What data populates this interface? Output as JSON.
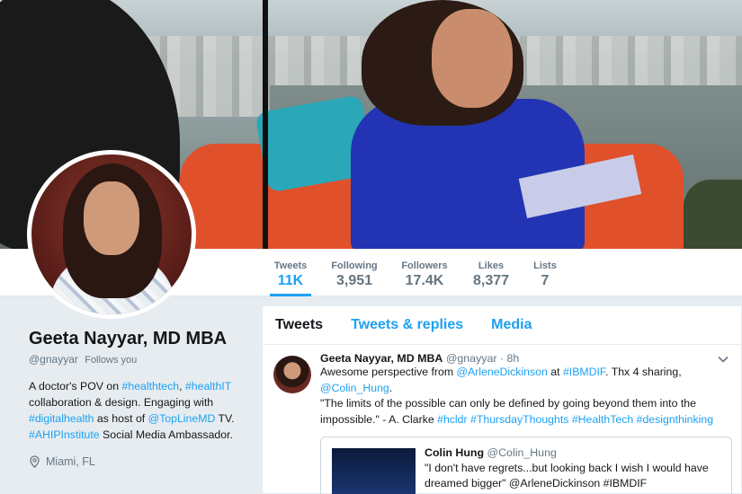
{
  "stats": [
    {
      "label": "Tweets",
      "value": "11K"
    },
    {
      "label": "Following",
      "value": "3,951"
    },
    {
      "label": "Followers",
      "value": "17.4K"
    },
    {
      "label": "Likes",
      "value": "8,377"
    },
    {
      "label": "Lists",
      "value": "7"
    }
  ],
  "profile": {
    "name": "Geeta Nayyar, MD MBA",
    "handle": "@gnayyar",
    "follows_you": "Follows you",
    "bio": [
      {
        "t": "A doctor's POV on ",
        "link": false
      },
      {
        "t": "#healthtech",
        "link": true
      },
      {
        "t": ", ",
        "link": false
      },
      {
        "t": "#healthIT",
        "link": true
      },
      {
        "t": " collaboration & design. Engaging with ",
        "link": false
      },
      {
        "t": "#digitalhealth",
        "link": true
      },
      {
        "t": " as host of ",
        "link": false
      },
      {
        "t": "@TopLineMD",
        "link": true
      },
      {
        "t": " TV. ",
        "link": false
      },
      {
        "t": "#AHIPInstitute",
        "link": true
      },
      {
        "t": " Social Media Ambassador.",
        "link": false
      }
    ],
    "location": "Miami, FL"
  },
  "tabs": [
    "Tweets",
    "Tweets & replies",
    "Media"
  ],
  "tweet": {
    "name": "Geeta Nayyar, MD MBA",
    "handle": "@gnayyar",
    "time": "· 8h",
    "line1": [
      {
        "t": "Awesome perspective from ",
        "link": false
      },
      {
        "t": "@ArleneDickinson",
        "link": true
      },
      {
        "t": " at ",
        "link": false
      },
      {
        "t": "#IBMDIF",
        "link": true
      },
      {
        "t": ". Thx 4 sharing,",
        "link": false
      }
    ],
    "line2": "@Colin_Hung",
    "line2_end": ".",
    "quote_text": [
      {
        "t": "\"The limits of the possible can only be defined by going beyond them into the impossible.\" - A. Clarke ",
        "link": false
      },
      {
        "t": "#hcldr",
        "link": true
      },
      {
        "t": " ",
        "link": false
      },
      {
        "t": "#ThursdayThoughts",
        "link": true
      },
      {
        "t": " ",
        "link": false
      },
      {
        "t": "#HealthTech",
        "link": true
      },
      {
        "t": " ",
        "link": false
      },
      {
        "t": "#designthinking",
        "link": true
      }
    ]
  },
  "quote": {
    "name": "Colin Hung",
    "handle": "@Colin_Hung",
    "text": "\"I don't have regrets...but looking back I wish I would have dreamed bigger\" @ArleneDickinson #IBMDIF"
  },
  "icons": {
    "location": "location-pin-icon",
    "caret": "chevron-down-icon"
  },
  "colors": {
    "accent": "#1da1f2",
    "text": "#14171a",
    "muted": "#657786"
  }
}
